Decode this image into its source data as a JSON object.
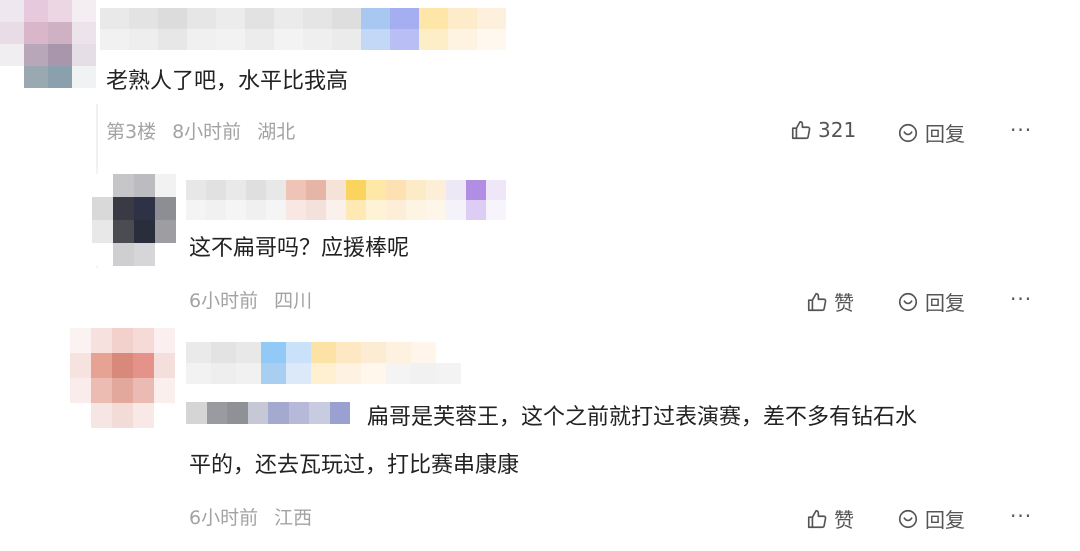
{
  "comments": [
    {
      "text": "老熟人了吧，水平比我高",
      "floor": "第3楼",
      "time": "8小时前",
      "location": "湖北",
      "like_label": "321",
      "reply_label": "回复",
      "more_label": "···"
    },
    {
      "text": "这不扁哥吗？应援棒呢",
      "time": "6小时前",
      "location": "四川",
      "like_label": "赞",
      "reply_label": "回复",
      "more_label": "···"
    },
    {
      "text_line1": "扁哥是芙蓉王，这个之前就打过表演赛，差不多有钻石水",
      "text_line2": "平的，还去瓦玩过，打比赛串康康",
      "time": "6小时前",
      "location": "江西",
      "like_label": "赞",
      "reply_label": "回复",
      "more_label": "···"
    }
  ],
  "colors": {
    "text": "#222222",
    "meta": "#a3a3a3",
    "action": "#555555"
  }
}
